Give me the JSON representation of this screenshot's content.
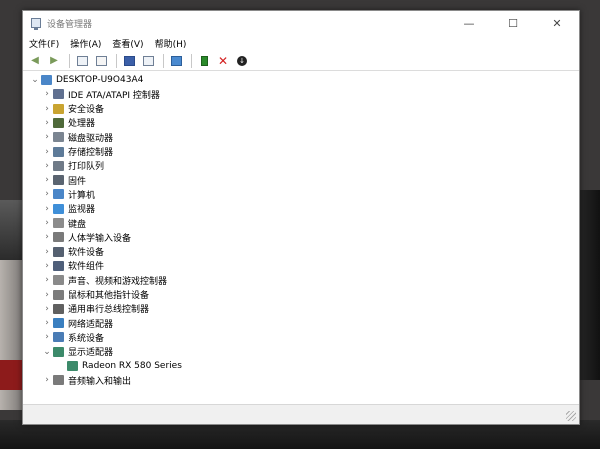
{
  "window": {
    "title": "设备管理器"
  },
  "menu": [
    "文件(F)",
    "操作(A)",
    "查看(V)",
    "帮助(H)"
  ],
  "toolbar_icons": [
    "back-arrow-icon",
    "forward-arrow-icon",
    "properties-icon",
    "list-view-icon",
    "help-icon",
    "resources-icon",
    "monitor-icon",
    "update-driver-icon",
    "uninstall-x-icon",
    "download-icon"
  ],
  "colors": {
    "uninstall": "#d42020",
    "update": "#2a8a2a"
  },
  "tree": {
    "root": "DESKTOP-U9O43A4",
    "items": [
      {
        "label": "IDE ATA/ATAPI 控制器",
        "icon": "#607090"
      },
      {
        "label": "安全设备",
        "icon": "#c9a431"
      },
      {
        "label": "处理器",
        "icon": "#4f6a3a"
      },
      {
        "label": "磁盘驱动器",
        "icon": "#7b8591"
      },
      {
        "label": "存储控制器",
        "icon": "#5e7b99"
      },
      {
        "label": "打印队列",
        "icon": "#6f7a87"
      },
      {
        "label": "固件",
        "icon": "#5a6470"
      },
      {
        "label": "计算机",
        "icon": "#4a86c8"
      },
      {
        "label": "监视器",
        "icon": "#3f8fd8"
      },
      {
        "label": "键盘",
        "icon": "#8c8c8c"
      },
      {
        "label": "人体学输入设备",
        "icon": "#7a7a7a"
      },
      {
        "label": "软件设备",
        "icon": "#556070"
      },
      {
        "label": "软件组件",
        "icon": "#4f5f7a"
      },
      {
        "label": "声音、视频和游戏控制器",
        "icon": "#8a8a8a"
      },
      {
        "label": "鼠标和其他指针设备",
        "icon": "#7c7c7c"
      },
      {
        "label": "通用串行总线控制器",
        "icon": "#606060"
      },
      {
        "label": "网络适配器",
        "icon": "#3a7fc0"
      },
      {
        "label": "系统设备",
        "icon": "#4a7cb5"
      },
      {
        "label": "显示适配器",
        "icon": "#3c8a6a",
        "expanded": true
      },
      {
        "label": "Radeon RX 580 Series",
        "icon": "#3c8a6a",
        "child": true
      },
      {
        "label": "音频输入和输出",
        "icon": "#7a7a7a"
      }
    ]
  }
}
